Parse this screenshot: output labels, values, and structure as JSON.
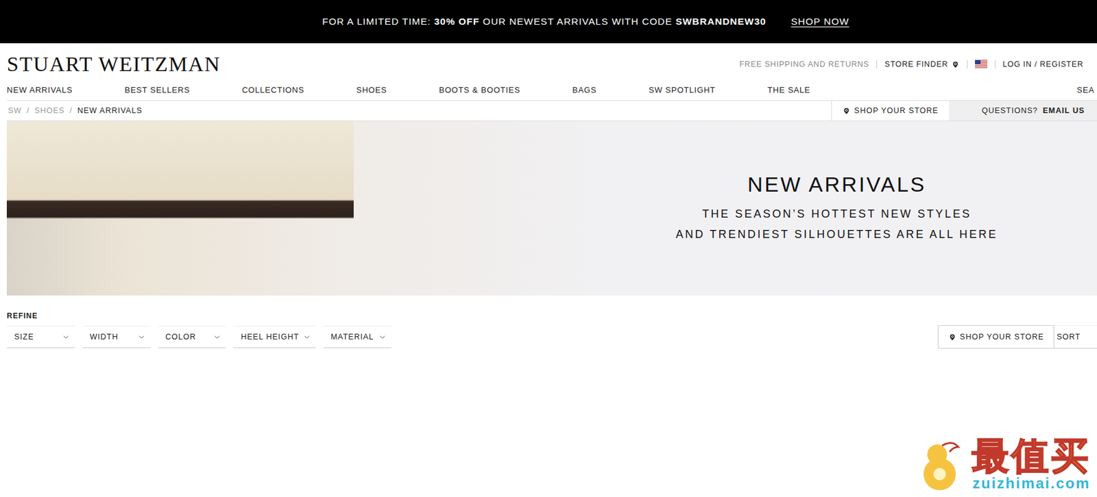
{
  "banner": {
    "segments": [
      {
        "text": "FOR A LIMITED TIME: ",
        "bold": false
      },
      {
        "text": "30% OFF",
        "bold": true
      },
      {
        "text": " OUR NEWEST ARRIVALS WITH CODE ",
        "bold": false
      },
      {
        "text": "SWBRANDNEW30",
        "bold": true
      }
    ],
    "link": "SHOP NOW"
  },
  "logo": "STUART WEITZMAN",
  "utility": {
    "shipping": "FREE SHIPPING AND RETURNS",
    "store_finder": "STORE FINDER",
    "account": "LOG IN / REGISTER"
  },
  "nav": {
    "items": [
      "NEW ARRIVALS",
      "BEST SELLERS",
      "COLLECTIONS",
      "SHOES",
      "BOOTS & BOOTIES",
      "BAGS",
      "SW SPOTLIGHT",
      "THE SALE"
    ],
    "cut": "SEA"
  },
  "breadcrumb": {
    "separator": "/",
    "items": [
      {
        "label": "SW",
        "current": false
      },
      {
        "label": "SHOES",
        "current": false
      },
      {
        "label": "NEW ARRIVALS",
        "current": true
      }
    ]
  },
  "store_bar": {
    "shop_store": "SHOP YOUR STORE",
    "questions": "QUESTIONS?",
    "email": "EMAIL US"
  },
  "hero": {
    "title": "NEW ARRIVALS",
    "lines": [
      "THE SEASON’S HOTTEST NEW STYLES",
      "AND TRENDIEST SILHOUETTES ARE ALL HERE"
    ]
  },
  "refine": {
    "label": "REFINE",
    "filters": [
      "SIZE",
      "WIDTH",
      "COLOR",
      "HEEL HEIGHT",
      "MATERIAL"
    ],
    "shop_store": "SHOP YOUR STORE",
    "sort": "SORT"
  },
  "watermark": {
    "brand": "最值买",
    "url": "zuizhimai.com"
  }
}
